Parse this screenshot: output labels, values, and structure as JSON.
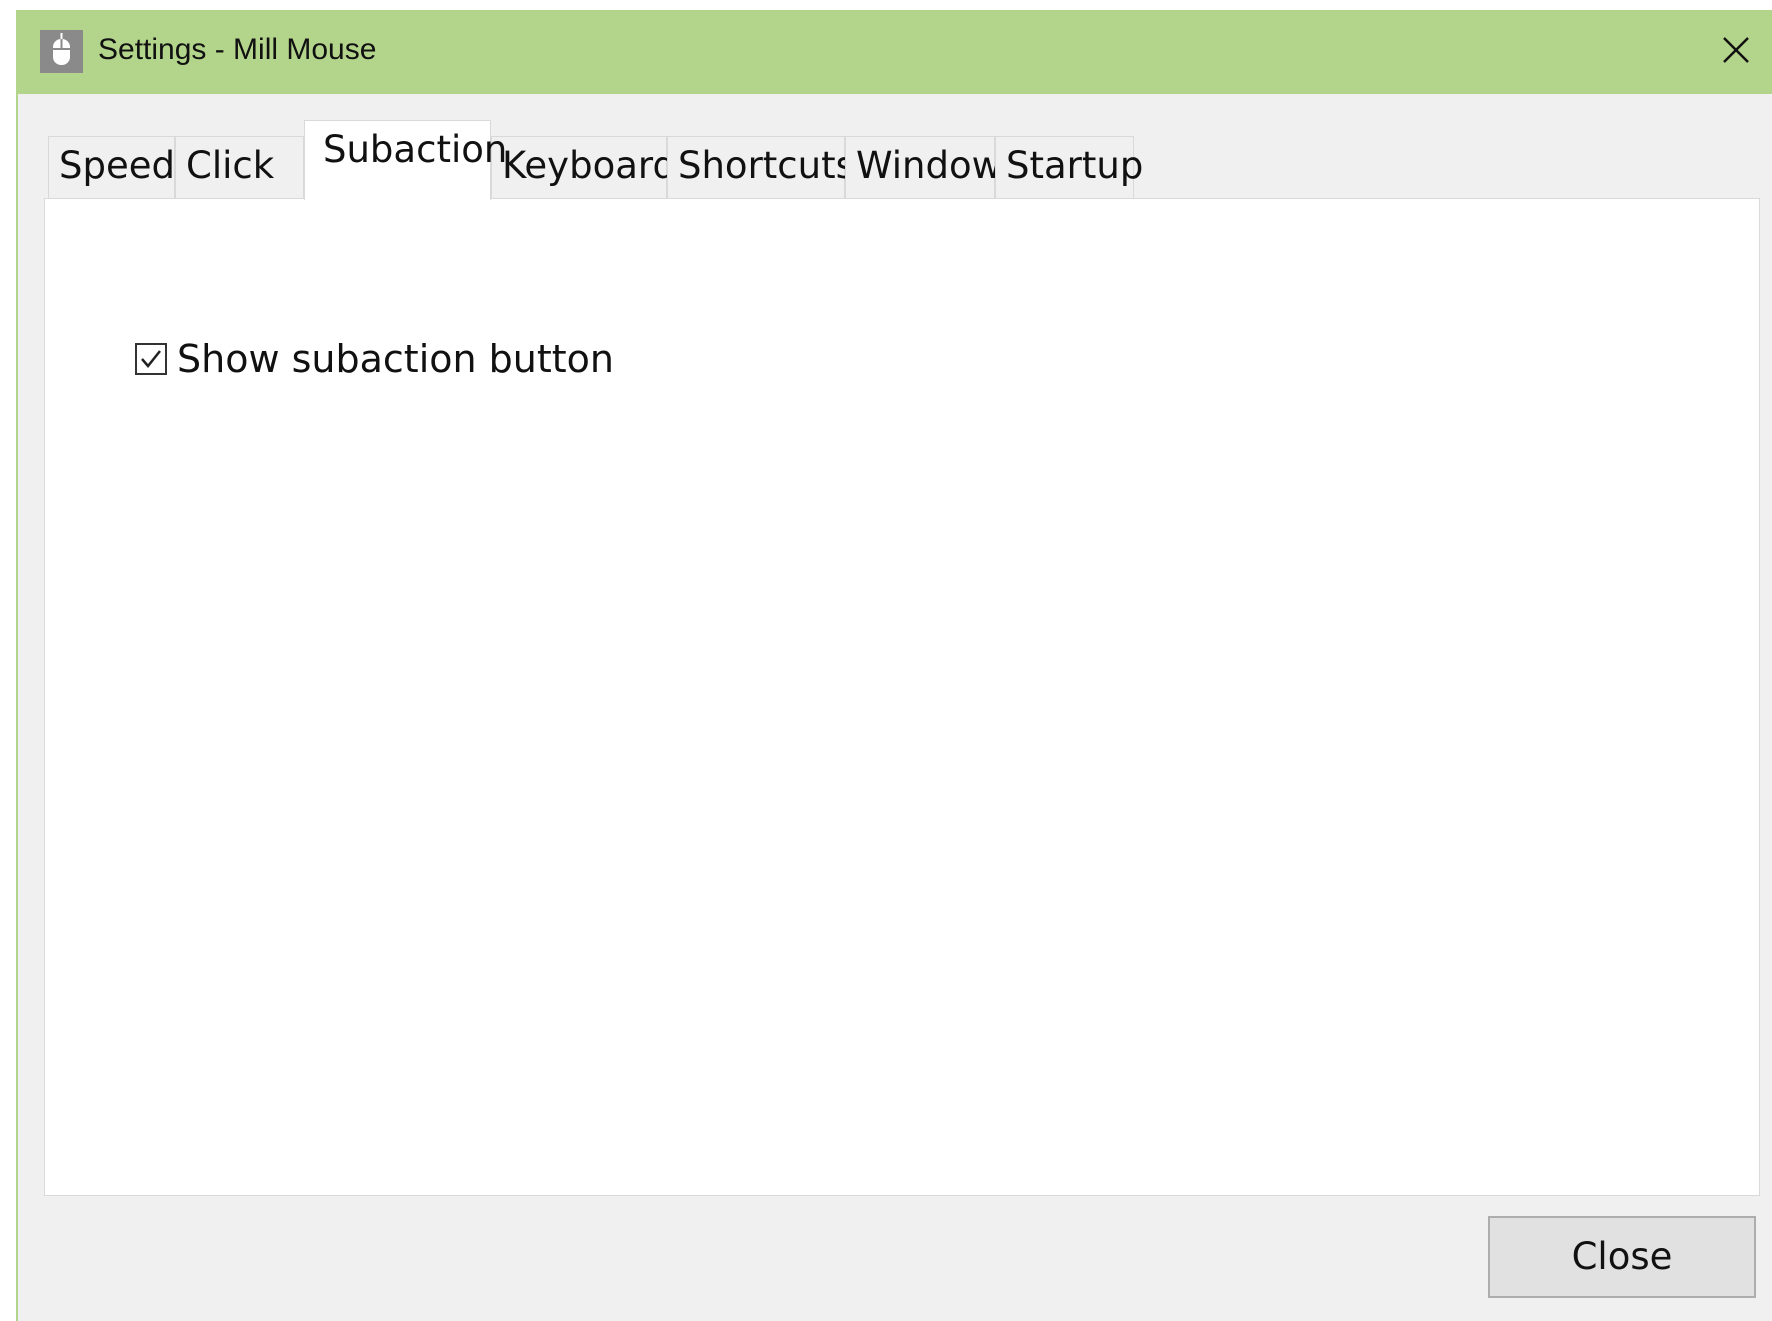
{
  "window": {
    "title": "Settings - Mill Mouse",
    "titlebar_color": "#b3d58b",
    "app_icon": "mouse-icon",
    "close_icon": "close-icon"
  },
  "tabs": [
    {
      "label": "Speed",
      "active": false
    },
    {
      "label": "Click",
      "active": false
    },
    {
      "label": "Subaction",
      "active": true
    },
    {
      "label": "Keyboard",
      "active": false
    },
    {
      "label": "Shortcuts",
      "active": false
    },
    {
      "label": "Window",
      "active": false
    },
    {
      "label": "Startup",
      "active": false
    }
  ],
  "subaction_panel": {
    "show_subaction_button": {
      "label": "Show subaction button",
      "checked": true
    }
  },
  "footer": {
    "close_label": "Close"
  }
}
